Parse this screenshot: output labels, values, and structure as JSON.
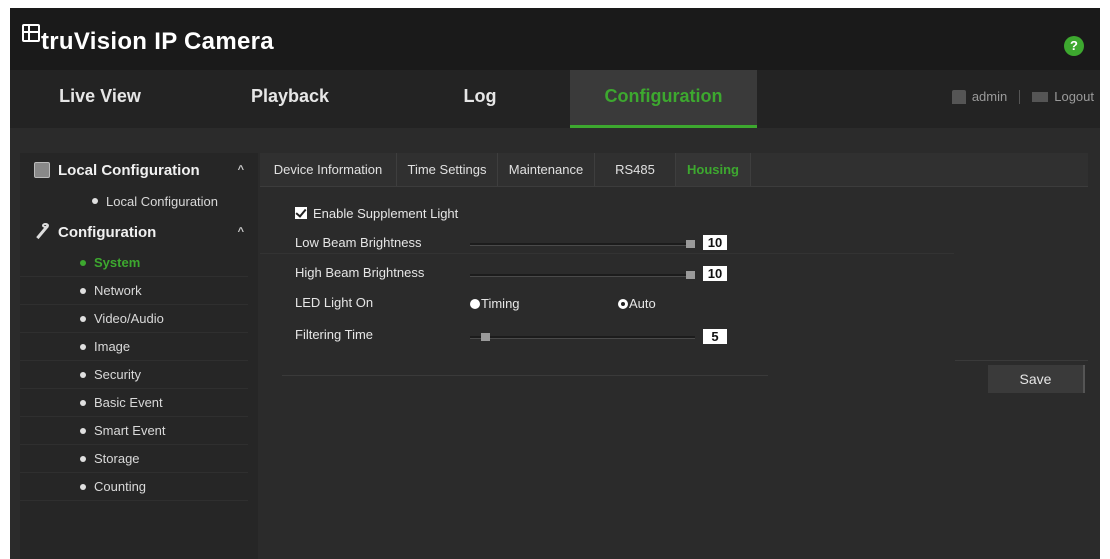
{
  "header": {
    "brand": "truVision IP Camera",
    "help_icon": "question-mark-icon",
    "help_label": "?"
  },
  "nav": {
    "tabs": [
      {
        "label": "Live View"
      },
      {
        "label": "Playback"
      },
      {
        "label": "Log"
      },
      {
        "label": "Configuration",
        "active": true
      }
    ],
    "user": "admin",
    "logout": "Logout"
  },
  "sidebar": {
    "local": {
      "title": "Local Configuration",
      "items": [
        "Local Configuration"
      ]
    },
    "config": {
      "title": "Configuration",
      "items": [
        "System",
        "Network",
        "Video/Audio",
        "Image",
        "Security",
        "Basic Event",
        "Smart Event",
        "Storage",
        "Counting"
      ],
      "active": "System"
    },
    "caret": "^"
  },
  "subtabs": [
    "Device Information",
    "Time Settings",
    "Maintenance",
    "RS485",
    "Housing"
  ],
  "housing": {
    "enable_label": "Enable Supplement Light",
    "enable_checked": true,
    "low_beam": {
      "label": "Low Beam Brightness",
      "value": "10",
      "level": 1.0
    },
    "high_beam": {
      "label": "High Beam Brightness",
      "value": "10",
      "level": 1.0
    },
    "led": {
      "label": "LED Light On",
      "options": [
        "Timing",
        "Auto"
      ],
      "selected": "Auto"
    },
    "filtering": {
      "label": "Filtering Time",
      "value": "5",
      "level": 0.05
    }
  },
  "save_label": "Save",
  "colors": {
    "accent": "#3da82f",
    "background": "#2b2b2b",
    "header": "#1a1a1a"
  }
}
